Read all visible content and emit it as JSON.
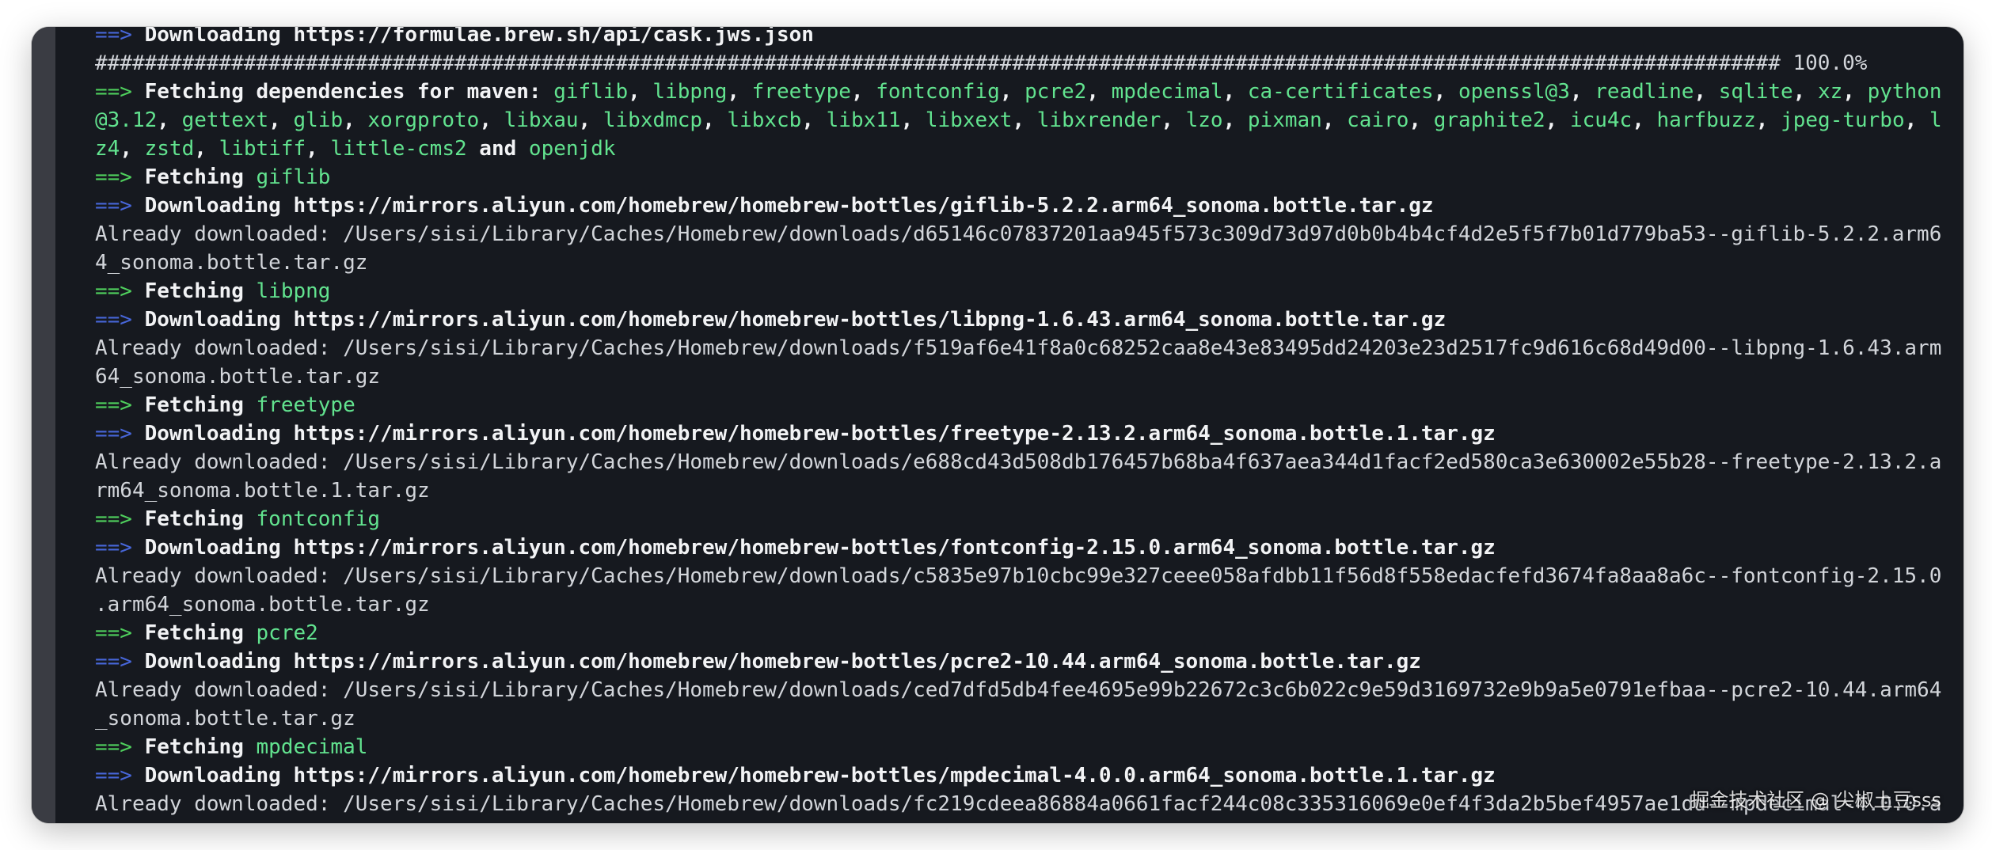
{
  "terminal": {
    "line_0_arrow": "==>",
    "line_0_text": " Downloading https://formulae.brew.sh/api/cask.jws.json",
    "line_1_text": "######################################################################################################################################## 100.0%",
    "line_2_arrow": "==>",
    "line_2_label": " Fetching dependencies for maven: ",
    "line_2_pkgs": [
      "giflib",
      ", ",
      "libpng",
      ", ",
      "freetype",
      ", ",
      "fontconfig",
      ", ",
      "pcre2",
      ", ",
      "mpdecimal",
      ", ",
      "ca-certificates",
      ", ",
      "openssl@3",
      ", ",
      "readline",
      ", ",
      "sqlite",
      ", ",
      "xz",
      ", ",
      "python"
    ],
    "line_3_pkgs": [
      "@3.12",
      ", ",
      "gettext",
      ", ",
      "glib",
      ", ",
      "xorgproto",
      ", ",
      "libxau",
      ", ",
      "libxdmcp",
      ", ",
      "libxcb",
      ", ",
      "libx11",
      ", ",
      "libxext",
      ", ",
      "libxrender",
      ", ",
      "lzo",
      ", ",
      "pixman",
      ", ",
      "cairo",
      ", ",
      "graphite2",
      ", ",
      "icu4c",
      ", ",
      "harfbuzz",
      ", ",
      "jpeg-turbo",
      ", ",
      "l"
    ],
    "line_4_pkgs": [
      "z4",
      ", ",
      "zstd",
      ", ",
      "libtiff",
      ", ",
      "little-cms2",
      " and ",
      "openjdk"
    ],
    "blocks": [
      {
        "fetch_label": " Fetching ",
        "pkg": "giflib",
        "download": " Downloading https://mirrors.aliyun.com/homebrew/homebrew-bottles/giflib-5.2.2.arm64_sonoma.bottle.tar.gz",
        "already_1": "Already downloaded: /Users/sisi/Library/Caches/Homebrew/downloads/d65146c07837201aa945f573c309d73d97d0b0b4b4cf4d2e5f5f7b01d779ba53--giflib-5.2.2.arm6",
        "already_2": "4_sonoma.bottle.tar.gz"
      },
      {
        "fetch_label": " Fetching ",
        "pkg": "libpng",
        "download": " Downloading https://mirrors.aliyun.com/homebrew/homebrew-bottles/libpng-1.6.43.arm64_sonoma.bottle.tar.gz",
        "already_1": "Already downloaded: /Users/sisi/Library/Caches/Homebrew/downloads/f519af6e41f8a0c68252caa8e43e83495dd24203e23d2517fc9d616c68d49d00--libpng-1.6.43.arm",
        "already_2": "64_sonoma.bottle.tar.gz"
      },
      {
        "fetch_label": " Fetching ",
        "pkg": "freetype",
        "download": " Downloading https://mirrors.aliyun.com/homebrew/homebrew-bottles/freetype-2.13.2.arm64_sonoma.bottle.1.tar.gz",
        "already_1": "Already downloaded: /Users/sisi/Library/Caches/Homebrew/downloads/e688cd43d508db176457b68ba4f637aea344d1facf2ed580ca3e630002e55b28--freetype-2.13.2.a",
        "already_2": "rm64_sonoma.bottle.1.tar.gz"
      },
      {
        "fetch_label": " Fetching ",
        "pkg": "fontconfig",
        "download": " Downloading https://mirrors.aliyun.com/homebrew/homebrew-bottles/fontconfig-2.15.0.arm64_sonoma.bottle.tar.gz",
        "already_1": "Already downloaded: /Users/sisi/Library/Caches/Homebrew/downloads/c5835e97b10cbc99e327ceee058afdbb11f56d8f558edacfefd3674fa8aa8a6c--fontconfig-2.15.0",
        "already_2": ".arm64_sonoma.bottle.tar.gz"
      },
      {
        "fetch_label": " Fetching ",
        "pkg": "pcre2",
        "download": " Downloading https://mirrors.aliyun.com/homebrew/homebrew-bottles/pcre2-10.44.arm64_sonoma.bottle.tar.gz",
        "already_1": "Already downloaded: /Users/sisi/Library/Caches/Homebrew/downloads/ced7dfd5db4fee4695e99b22672c3c6b022c9e59d3169732e9b9a5e0791efbaa--pcre2-10.44.arm64",
        "already_2": "_sonoma.bottle.tar.gz"
      },
      {
        "fetch_label": " Fetching ",
        "pkg": "mpdecimal",
        "download": " Downloading https://mirrors.aliyun.com/homebrew/homebrew-bottles/mpdecimal-4.0.0.arm64_sonoma.bottle.1.tar.gz",
        "already_1": "Already downloaded: /Users/sisi/Library/Caches/Homebrew/downloads/fc219cdeea86884a0661facf244c08c335316069e0ef4f3da2b5bef4957ae1dd--mpdecimal-4.0.0.a",
        "already_2": ""
      }
    ]
  },
  "watermark": "掘金技术社区 @ 尖椒土豆sss",
  "colors": {
    "background": "#16191f",
    "arrow_green": "#4fd05d",
    "arrow_blue": "#4766d9",
    "package": "#62e38f",
    "text": "#e7e9ec"
  }
}
